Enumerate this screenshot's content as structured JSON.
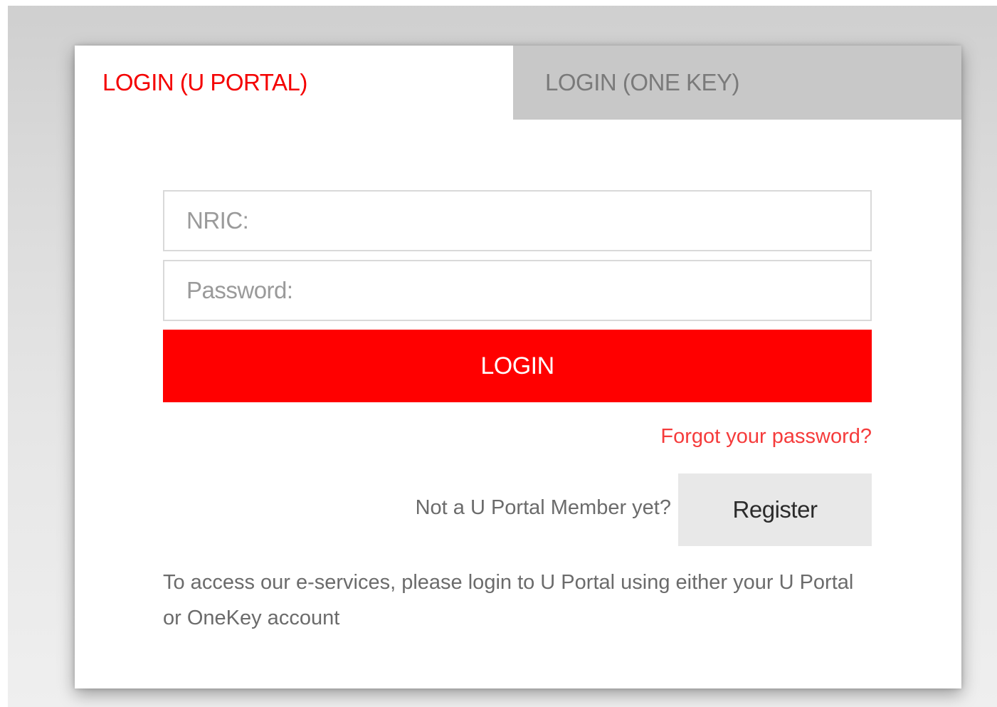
{
  "tabs": {
    "uportal": {
      "label": "LOGIN (U PORTAL)",
      "active": true
    },
    "onekey": {
      "label": "LOGIN (ONE KEY)",
      "active": false
    }
  },
  "form": {
    "nric": {
      "placeholder": "NRIC:",
      "value": ""
    },
    "password": {
      "placeholder": "Password:",
      "value": ""
    },
    "login_label": "LOGIN",
    "forgot_label": "Forgot your password?"
  },
  "register": {
    "prompt": "Not a U Portal Member yet?",
    "button_label": "Register"
  },
  "info": {
    "text": "To access our e-services, please login to U Portal using either your U Portal or OneKey account"
  },
  "colors": {
    "accent": "#ff0000",
    "active_tab_text": "#f40000",
    "inactive_tab_bg": "#c8c8c8",
    "register_bg": "#e8e8e8"
  }
}
